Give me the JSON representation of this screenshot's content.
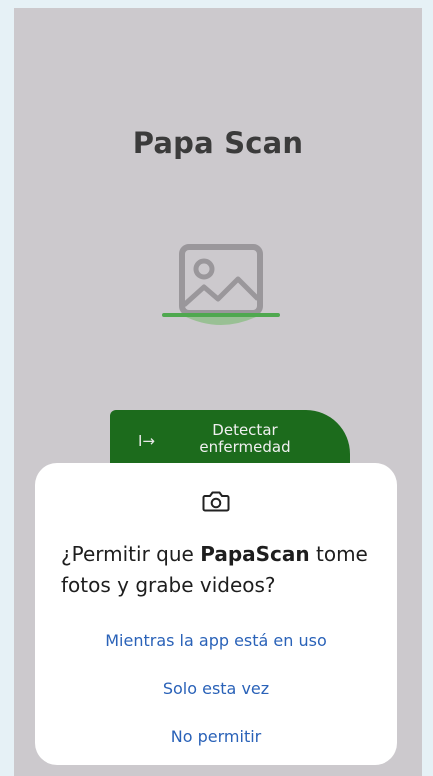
{
  "app": {
    "title": "Papa Scan"
  },
  "main": {
    "image_placeholder_icon": "image-placeholder-icon",
    "detect_button": {
      "icon": "arrow-right-bar-icon",
      "arrow_glyph": "I→",
      "label": "Detectar\nenfermedad"
    }
  },
  "permission_dialog": {
    "icon": "camera-icon",
    "message_prefix": "¿Permitir que ",
    "message_app": "PapaScan",
    "message_suffix": " tome fotos y grabe videos?",
    "options": [
      "Mientras la app está en uso",
      "Solo esta vez",
      "No permitir"
    ]
  },
  "colors": {
    "screen_bg": "#ccc9cd",
    "button_green": "#1c6b1c",
    "accent_green_line": "#4fa84f",
    "dialog_bg": "#ffffff",
    "option_blue": "#2a62b8"
  }
}
